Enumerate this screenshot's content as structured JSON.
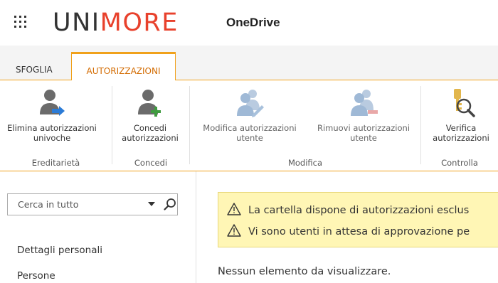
{
  "header": {
    "brand_part1": "UNI",
    "brand_part2": "MORE",
    "app_name": "OneDrive"
  },
  "ribbon": {
    "tabs": [
      {
        "label": "SFOGLIA",
        "selected": false
      },
      {
        "label": "AUTORIZZAZIONI",
        "selected": true
      }
    ],
    "buttons": [
      {
        "label": "Elimina autorizzazioni univoche",
        "icon": "delete-unique-permissions-icon",
        "enabled": true
      },
      {
        "label": "Concedi autorizzazioni",
        "icon": "grant-permissions-icon",
        "enabled": true
      },
      {
        "label": "Modifica autorizzazioni utente",
        "icon": "edit-user-permissions-icon",
        "enabled": false
      },
      {
        "label": "Rimuovi autorizzazioni utente",
        "icon": "remove-user-permissions-icon",
        "enabled": false
      },
      {
        "label": "Verifica autorizzazioni",
        "icon": "check-permissions-icon",
        "enabled": true
      }
    ],
    "groups": [
      "Ereditarietà",
      "Concedi",
      "Modifica",
      "Controlla"
    ]
  },
  "left_nav": {
    "search_placeholder": "Cerca in tutto",
    "items": [
      "Dettagli personali",
      "Persone"
    ]
  },
  "main": {
    "warnings": [
      "La cartella dispone di autorizzazioni esclus",
      "Vi sono utenti in attesa di approvazione pe"
    ],
    "empty_message": "Nessun elemento da visualizzare."
  },
  "colors": {
    "accent": "#f0a11b",
    "brand_red": "#e8412c",
    "selected_tab_text": "#d36b00",
    "warning_bg": "#fff6b5"
  }
}
